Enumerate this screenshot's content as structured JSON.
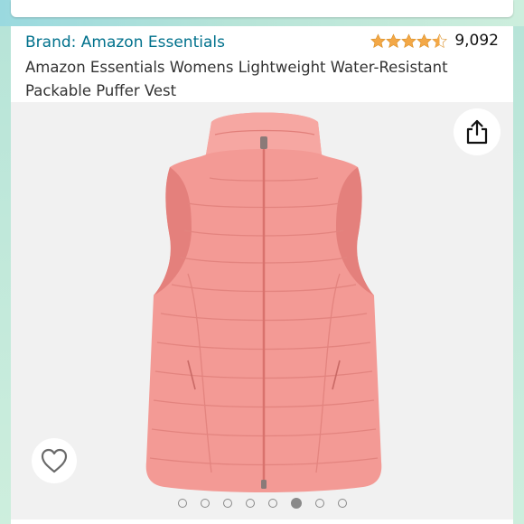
{
  "product": {
    "brand_line": "Brand: Amazon Essentials",
    "title": "Amazon Essentials Womens Lightweight Water-Resistant Packable Puffer Vest",
    "rating": {
      "stars": 4.5,
      "count": "9,092",
      "star_color": "#f3a847"
    },
    "image": {
      "subject": "pink puffer vest",
      "color": "#f39a95"
    }
  },
  "actions": {
    "share_icon": "share-icon",
    "wishlist_icon": "heart-outline-icon"
  },
  "carousel": {
    "total": 8,
    "active_index": 5
  },
  "colors": {
    "brand_link": "#00718c",
    "image_bg": "#f1f1f1",
    "frame_accent": "#9ad9df"
  }
}
